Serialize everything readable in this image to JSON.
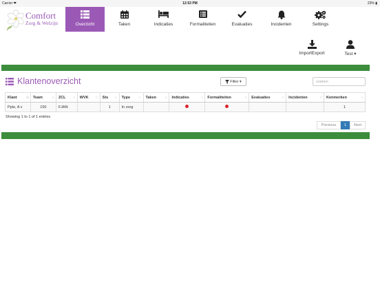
{
  "statusbar": {
    "carrier": "Carrier ❤",
    "time": "12:53 PM",
    "battery": "23% ▮"
  },
  "logo": {
    "line1": "Comfort",
    "line2": "Zorg & Welzijn"
  },
  "nav": [
    {
      "label": "Overzicht",
      "icon": "list-icon",
      "active": true
    },
    {
      "label": "Taken",
      "icon": "calendar-icon"
    },
    {
      "label": "Indicaties",
      "icon": "bed-icon"
    },
    {
      "label": "Formaliteiten",
      "icon": "list-alt-icon"
    },
    {
      "label": "Evaluaties",
      "icon": "check-icon"
    },
    {
      "label": "Incidenten",
      "icon": "bell-icon"
    },
    {
      "label": "Settings",
      "icon": "gears-icon"
    }
  ],
  "actions": {
    "import_export": "ImportExport",
    "user": "Test ▾"
  },
  "page": {
    "title": "Klantenoverzicht",
    "filter_label": "Filter ▾",
    "search_placeholder": "zoeken"
  },
  "table": {
    "columns": [
      "Klant",
      "Team",
      "ZCL",
      "WVK",
      "Sts",
      "Type",
      "Taken",
      "Indicaties",
      "Formaliteiten",
      "Evaluaties",
      "Incidenten",
      "Kenmerken"
    ],
    "rows": [
      {
        "klant": "Pple, A v",
        "team": "150",
        "zcl": "FJAN",
        "wvk": "",
        "sts": "1",
        "type": "In zorg",
        "taken": "",
        "indicaties": "red-dot",
        "formaliteiten": "red-dot",
        "evaluaties": "",
        "incidenten": "",
        "kenmerken": "1"
      }
    ]
  },
  "entries": "Showing 1 to 1 of 1 entries",
  "pager": {
    "previous": "Previous",
    "page": "1",
    "next": "Next"
  },
  "colors": {
    "accent": "#9b59b6",
    "green_bar": "#3c8d3c",
    "status_red": "#d9262b",
    "pager_active": "#337ab7"
  }
}
